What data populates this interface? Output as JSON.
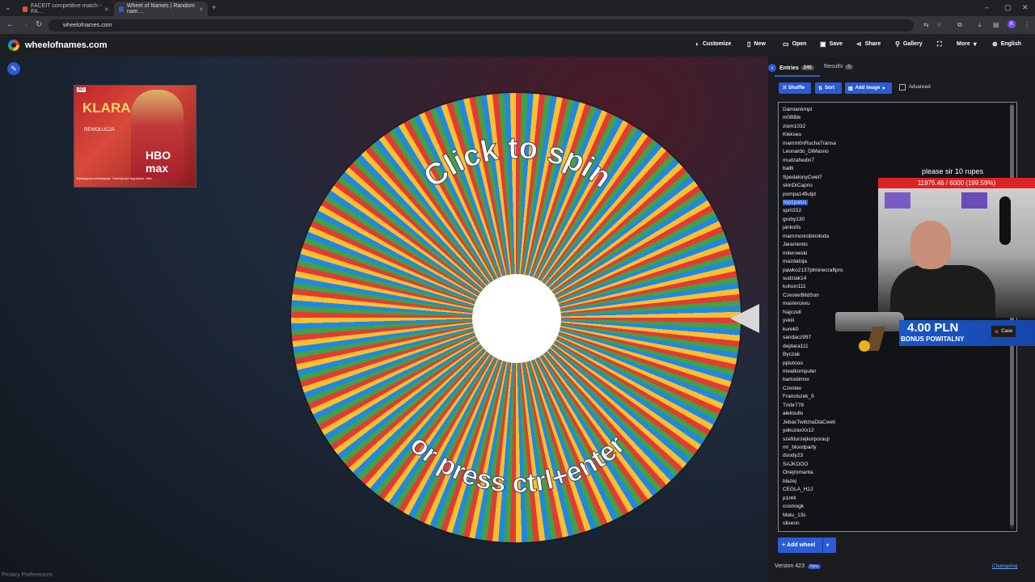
{
  "browser": {
    "tabs": [
      {
        "title": "FACEIT competitive match - FA…",
        "color": "#e8542a",
        "active": false
      },
      {
        "title": "Wheel of Names | Random nam…",
        "color": "#2c5bd6",
        "active": true
      }
    ],
    "url": "wheelofnames.com"
  },
  "site": {
    "name": "wheelofnames.com",
    "menu": [
      {
        "icon": "palette-icon",
        "label": "Customize"
      },
      {
        "icon": "file-icon",
        "label": "New"
      },
      {
        "icon": "folder-icon",
        "label": "Open"
      },
      {
        "icon": "save-icon",
        "label": "Save"
      },
      {
        "icon": "share-icon",
        "label": "Share"
      },
      {
        "icon": "search-icon",
        "label": "Gallery"
      },
      {
        "icon": "fullscreen-icon",
        "label": ""
      },
      {
        "icon": "chevron-down-icon",
        "label": "More"
      },
      {
        "icon": "globe-icon",
        "label": "English"
      }
    ]
  },
  "ad": {
    "label": "AD",
    "title_line1": "KLARA",
    "title_line2": "REWOLUCJA",
    "logo": "HBO max",
    "footer": "Wymagana subskrypcja. Obowiązuje regulamin. Max"
  },
  "wheel": {
    "prompt_top": "Click to spin",
    "prompt_bottom": "or press ctrl+enter",
    "colors": [
      "#e53935",
      "#43a047",
      "#1e88e5",
      "#fbc02d"
    ]
  },
  "privacy_link": "Privacy Preferences",
  "sidebar": {
    "tab_entries": "Entries",
    "entries_count": "240",
    "tab_results": "Results",
    "results_count": "0",
    "buttons": {
      "shuffle": "Shuffle",
      "sort": "Sort",
      "add_image": "Add image",
      "advanced": "Advanced"
    },
    "entries": [
      "Damiankmpl",
      "m0BBik",
      "ziom1032",
      "Klekseu",
      "mamm0nRuchaTransa",
      "Leonardo_DiMasno",
      "mudzahedin7",
      "ballti",
      "SpedalonyCwel7",
      "skinDiCaprio",
      "pompa14fiutjd",
      "top1patus",
      "sprit152",
      "gruby130",
      "janko0s",
      "mammonrobimiloda",
      "Jaramento",
      "milerowski",
      "mazdatoja",
      "pawko2137plminecraftpro",
      "sudziak14",
      "kulson111",
      "CzesterBildSon",
      "mastercexu",
      "Najczell",
      "yvkiii",
      "kurek0",
      "sandacz997",
      "dejdara111",
      "Byczak",
      "pplutooo",
      "meatkomputer",
      "bartoslimxx",
      "Czeslav",
      "Franciszek_9",
      "Tmbr778",
      "aleksullo",
      "JebacTwitchaDlaCweli",
      "yakuzaxXx12",
      "szefdurzejkorporacji",
      "mr_bloodparty",
      "doody23",
      "SAJKOOO",
      "Onejromanta",
      "blazej",
      "CEGLA_H2J",
      "p1nt4",
      "cosmogk",
      "Matu_13s",
      "olixenn"
    ],
    "selected_entry": "top1patus",
    "add_wheel": "Add wheel",
    "version": "Version 423",
    "new_badge": "New",
    "changelog": "Changelog"
  },
  "overlay": {
    "rupes_text": "please sir 10 rupes",
    "goal_text": "11975.46 / 6000 (199.59%)",
    "donation_amount": "4.00 PLN",
    "donation_label": "BONUS POWITALNY",
    "case_badge": "Case"
  }
}
